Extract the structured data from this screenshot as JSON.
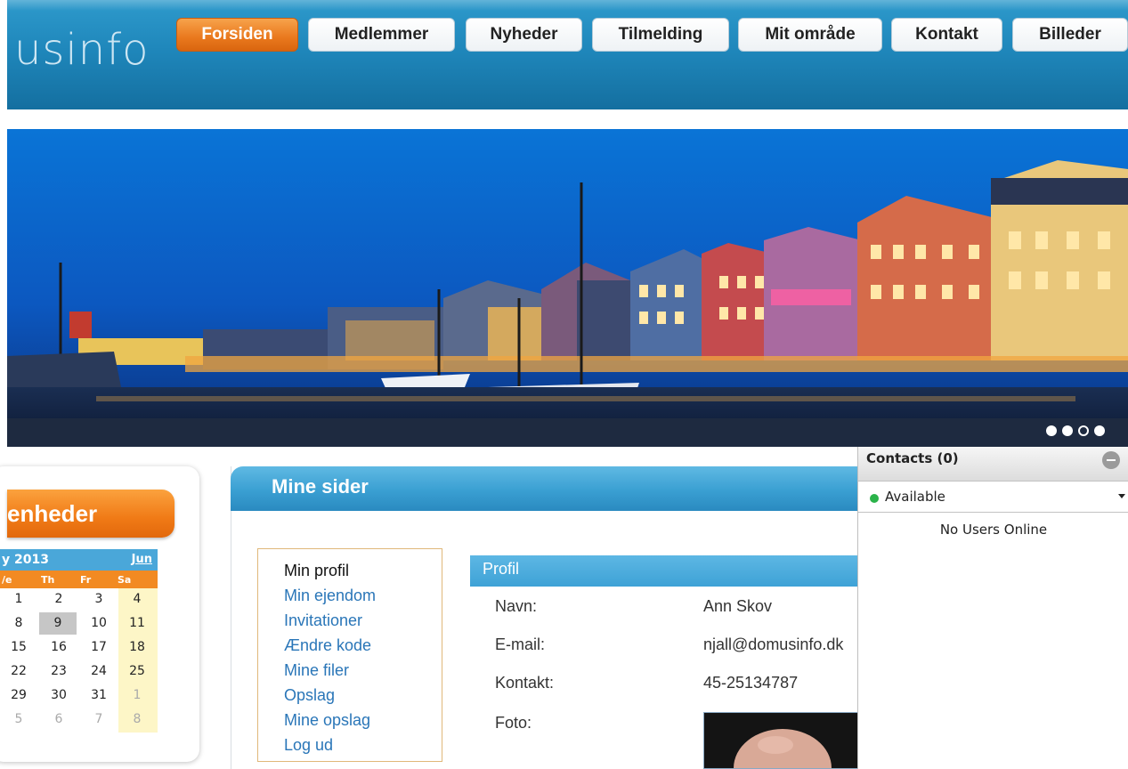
{
  "header": {
    "logo_text": "usinfo",
    "nav": [
      {
        "label": "Forsiden",
        "active": true
      },
      {
        "label": "Medlemmer",
        "active": false
      },
      {
        "label": "Nyheder",
        "active": false
      },
      {
        "label": "Tilmelding",
        "active": false
      },
      {
        "label": "Mit område",
        "active": false
      },
      {
        "label": "Kontakt",
        "active": false
      },
      {
        "label": "Billeder",
        "active": false
      }
    ]
  },
  "banner": {
    "slides": 4,
    "active_slide": 3
  },
  "calendar_panel": {
    "title": "enheder",
    "month_label": "y 2013",
    "next_label": "Jun",
    "day_headers": [
      "/e",
      "Th",
      "Fr",
      "Sa"
    ],
    "weeks": [
      [
        "1",
        "2",
        "3",
        "4"
      ],
      [
        "8",
        "9",
        "10",
        "11"
      ],
      [
        "15",
        "16",
        "17",
        "18"
      ],
      [
        "22",
        "23",
        "24",
        "25"
      ],
      [
        "29",
        "30",
        "31",
        "1"
      ],
      [
        "5",
        "6",
        "7",
        "8"
      ]
    ],
    "today": "9"
  },
  "main": {
    "title": "Mine sider",
    "menu": [
      {
        "label": "Min profil",
        "current": true
      },
      {
        "label": "Min ejendom",
        "current": false
      },
      {
        "label": "Invitationer",
        "current": false
      },
      {
        "label": "Ændre kode",
        "current": false
      },
      {
        "label": "Mine filer",
        "current": false
      },
      {
        "label": "Opslag",
        "current": false
      },
      {
        "label": "Mine opslag",
        "current": false
      },
      {
        "label": "Log ud",
        "current": false
      }
    ],
    "profile": {
      "heading": "Profil",
      "name_label": "Navn:",
      "name_value": "Ann Skov",
      "email_label": "E-mail:",
      "email_value": "njall@domusinfo.dk",
      "contact_label": "Kontakt:",
      "contact_value": "45-25134787",
      "photo_label": "Foto:"
    }
  },
  "contacts": {
    "title": "Contacts (0)",
    "status": "Available",
    "empty_text": "No Users Online",
    "status_color": "#2bb34a"
  },
  "colors": {
    "header_blue": "#1f87bb",
    "accent_orange": "#f07a16",
    "link_blue": "#2a76b8"
  }
}
